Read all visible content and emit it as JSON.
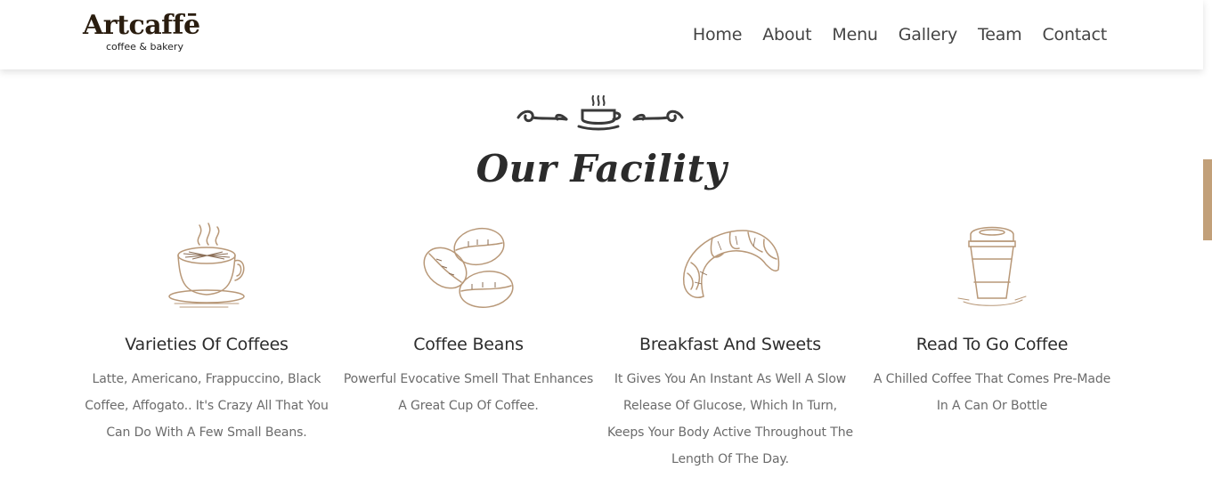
{
  "brand": {
    "name": "Artcaffē",
    "tagline": "coffee & bakery"
  },
  "nav": {
    "items": [
      {
        "label": "Home"
      },
      {
        "label": "About"
      },
      {
        "label": "Menu"
      },
      {
        "label": "Gallery"
      },
      {
        "label": "Team"
      },
      {
        "label": "Contact"
      }
    ]
  },
  "section": {
    "title": "Our Facility",
    "ornament_icon": "coffee-cup-flourish-icon"
  },
  "facilities": [
    {
      "icon": "coffee-cup-icon",
      "title": "Varieties Of Coffees",
      "lines": [
        "Latte, Americano, Frappuccino, Black",
        "Coffee, Affogato.. It's Crazy All That You",
        "Can Do With A Few Small Beans."
      ]
    },
    {
      "icon": "coffee-beans-icon",
      "title": "Coffee Beans",
      "lines": [
        "Powerful Evocative Smell That Enhances",
        "A Great Cup Of Coffee."
      ]
    },
    {
      "icon": "croissant-icon",
      "title": "Breakfast And Sweets",
      "lines": [
        "It Gives You An Instant As Well A Slow",
        "Release Of Glucose, Which In Turn,",
        "Keeps Your Body Active Throughout The",
        "Length Of The Day."
      ]
    },
    {
      "icon": "takeaway-cup-icon",
      "title": "Read To Go Coffee",
      "lines": [
        "A Chilled Coffee That Comes Pre-Made",
        "In A Can Or Bottle"
      ]
    }
  ],
  "colors": {
    "accent": "#c2a079",
    "sketch": "#b89878",
    "heading": "#2b2b2b",
    "body_text": "#6b6b6b"
  }
}
